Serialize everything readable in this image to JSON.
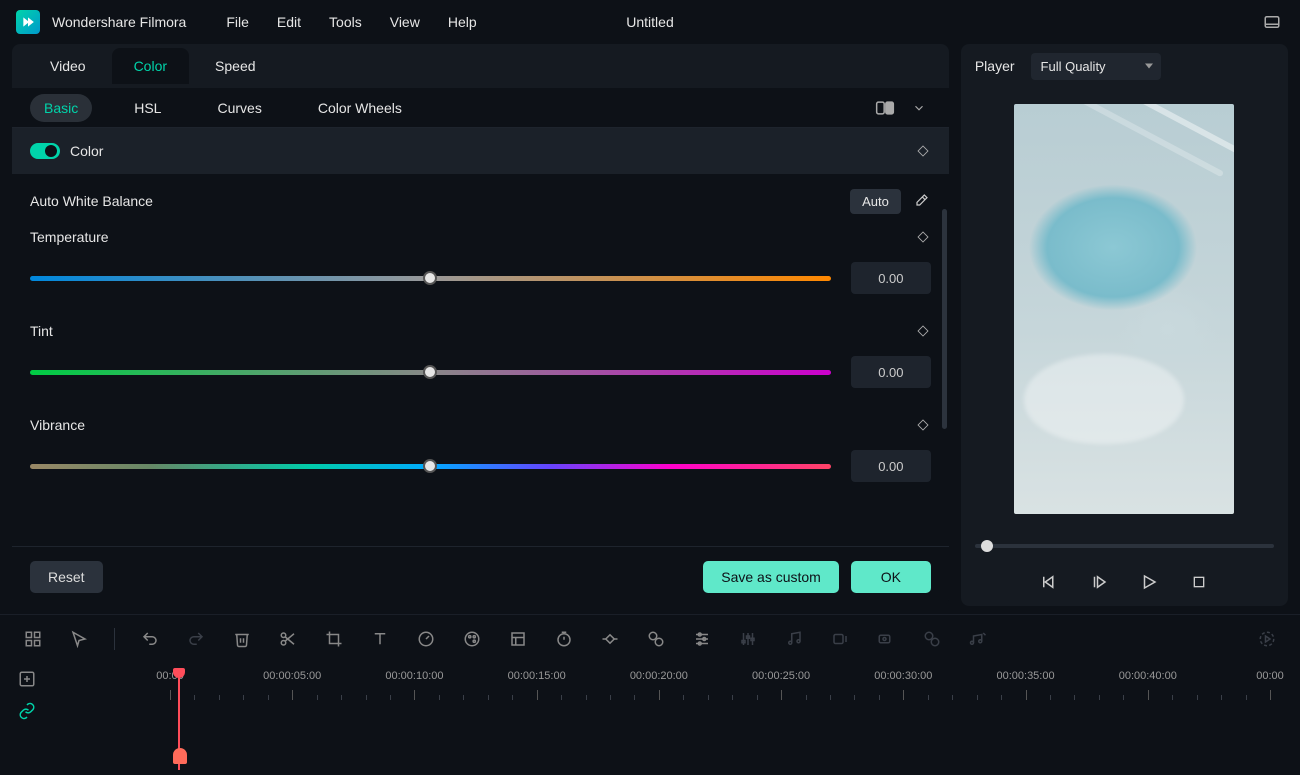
{
  "app": {
    "title": "Wondershare Filmora",
    "project": "Untitled"
  },
  "menu": [
    "File",
    "Edit",
    "Tools",
    "View",
    "Help"
  ],
  "tabs_primary": [
    "Video",
    "Color",
    "Speed"
  ],
  "tabs_primary_active": 1,
  "tabs_secondary": [
    "Basic",
    "HSL",
    "Curves",
    "Color Wheels"
  ],
  "tabs_secondary_active": 0,
  "section": {
    "title": "Color"
  },
  "awb": {
    "label": "Auto White Balance",
    "auto_btn": "Auto"
  },
  "sliders": {
    "temperature": {
      "label": "Temperature",
      "value": "0.00",
      "pos": 50
    },
    "tint": {
      "label": "Tint",
      "value": "0.00",
      "pos": 50
    },
    "vibrance": {
      "label": "Vibrance",
      "value": "0.00",
      "pos": 50
    }
  },
  "footer": {
    "reset": "Reset",
    "save_custom": "Save as custom",
    "ok": "OK"
  },
  "player": {
    "label": "Player",
    "quality": "Full Quality"
  },
  "timeline_labels": [
    "00:00",
    "00:00:05:00",
    "00:00:10:00",
    "00:00:15:00",
    "00:00:20:00",
    "00:00:25:00",
    "00:00:30:00",
    "00:00:35:00",
    "00:00:40:00",
    "00:00"
  ]
}
